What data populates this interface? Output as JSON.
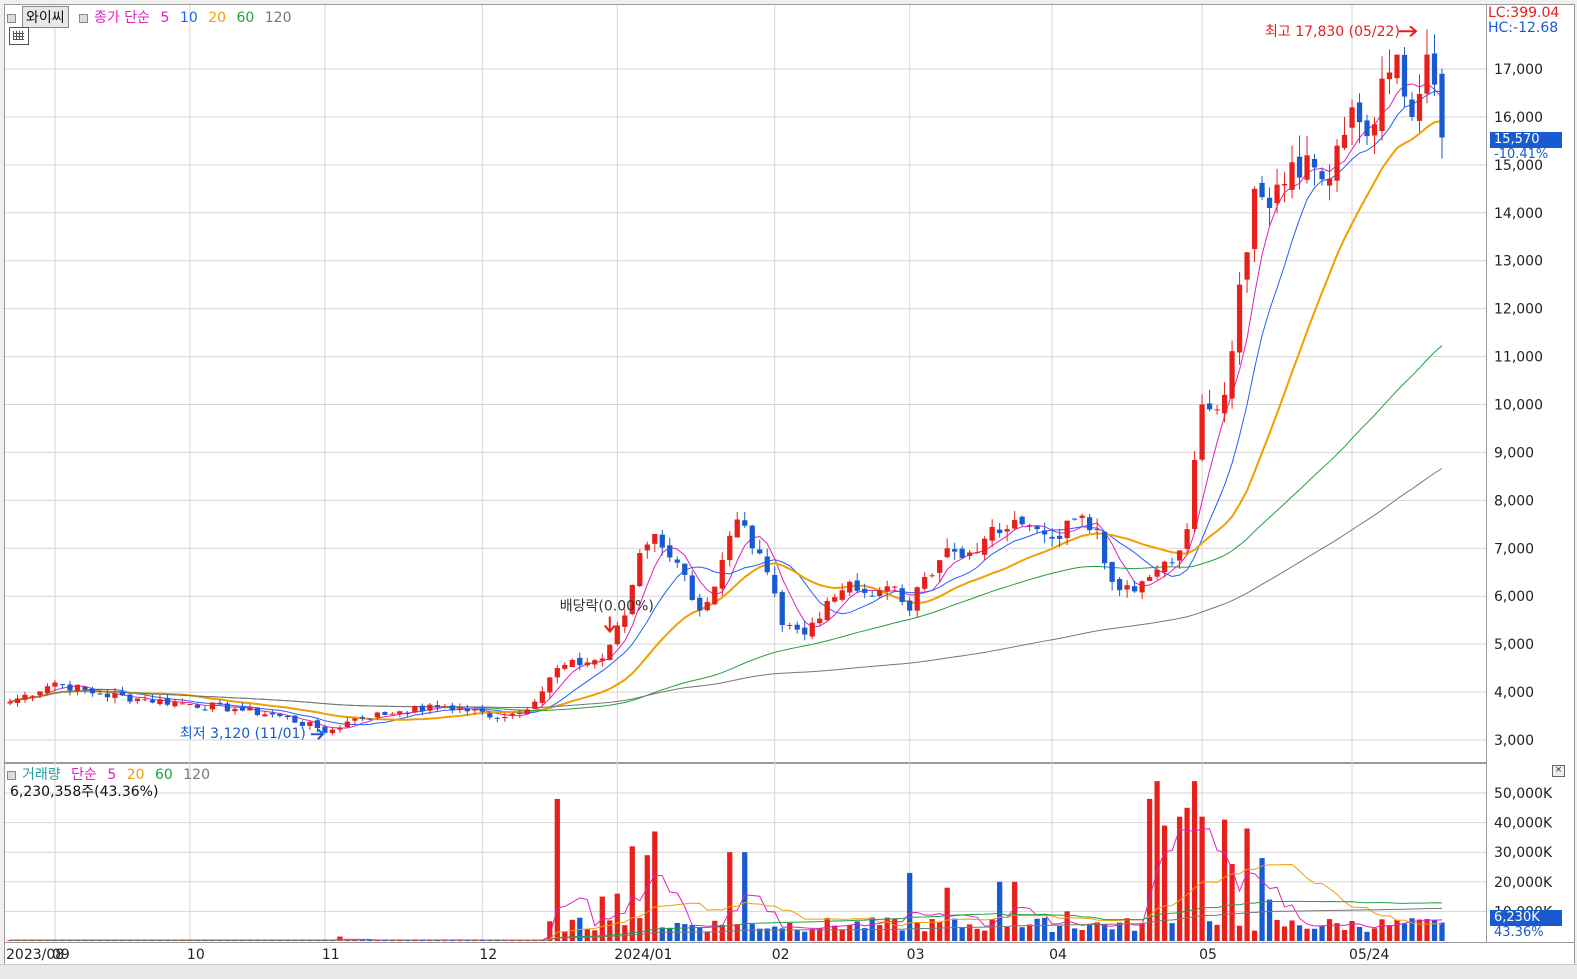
{
  "legend_price": {
    "name": "와이씨",
    "ma_label": "종가 단순",
    "periods": [
      "5",
      "10",
      "20",
      "60",
      "120"
    ],
    "period_colors": [
      "#e020c0",
      "#2060ff",
      "#f0a000",
      "#20a040",
      "#777777"
    ]
  },
  "legend_volume": {
    "label": "거래량",
    "ma_label": "단순",
    "periods": [
      "5",
      "20",
      "60",
      "120"
    ],
    "period_colors": [
      "#e020c0",
      "#f0a000",
      "#20a040",
      "#777777"
    ],
    "info": "6,230,358주(43.36%)"
  },
  "right_info": {
    "lc": "LC:399.04",
    "hc": "HC:-12.68",
    "price_tag": "15,570",
    "price_change": "-10.41%",
    "vol_tag": "6,230K",
    "vol_pct": "43.36%"
  },
  "annotations": {
    "high": "최고 17,830 (05/22)",
    "low": "최저 3,120 (11/01)",
    "dividend": "배당락(0.00%)"
  },
  "colors": {
    "up": "#e8201c",
    "down": "#1a5ad0",
    "grid": "#d6d6d6",
    "tag_bg": "#1a5ad0"
  },
  "icons": [
    "table-icon",
    "close-icon"
  ],
  "chart_data": {
    "type": "candlestick",
    "price_axis": {
      "ticks": [
        3000,
        4000,
        5000,
        6000,
        7000,
        8000,
        9000,
        10000,
        11000,
        12000,
        13000,
        14000,
        15000,
        16000,
        17000
      ],
      "labels": [
        "3,000",
        "4,000",
        "5,000",
        "6,000",
        "7,000",
        "8,000",
        "9,000",
        "10,000",
        "11,000",
        "12,000",
        "13,000",
        "14,000",
        "15,000",
        "16,000",
        "17,000"
      ],
      "range": [
        2600,
        18300
      ]
    },
    "volume_axis": {
      "ticks": [
        10000,
        20000,
        30000,
        40000,
        50000
      ],
      "labels": [
        "10,000K",
        "20,000K",
        "30,000K",
        "40,000K",
        "50,000K"
      ],
      "range": [
        0,
        55000
      ]
    },
    "date_labels": [
      {
        "label": "2023/08",
        "index": 0
      },
      {
        "label": "09",
        "index": 6
      },
      {
        "label": "10",
        "index": 24
      },
      {
        "label": "11",
        "index": 42
      },
      {
        "label": "12",
        "index": 63
      },
      {
        "label": "2024/01",
        "index": 81
      },
      {
        "label": "02",
        "index": 102
      },
      {
        "label": "03",
        "index": 120
      },
      {
        "label": "04",
        "index": 139
      },
      {
        "label": "05",
        "index": 159
      },
      {
        "label": "05/24",
        "index": 179
      }
    ],
    "high": {
      "value": 17830,
      "date": "05/22"
    },
    "low": {
      "value": 3120,
      "date": "11/01"
    },
    "anchors": [
      [
        0,
        3800
      ],
      [
        6,
        4200
      ],
      [
        12,
        3950
      ],
      [
        18,
        3850
      ],
      [
        24,
        3750
      ],
      [
        30,
        3650
      ],
      [
        36,
        3500
      ],
      [
        41,
        3250
      ],
      [
        42,
        3150
      ],
      [
        46,
        3450
      ],
      [
        52,
        3600
      ],
      [
        58,
        3700
      ],
      [
        66,
        3480
      ],
      [
        70,
        3800
      ],
      [
        73,
        4500
      ],
      [
        79,
        4700
      ],
      [
        82,
        5600
      ],
      [
        84,
        6900
      ],
      [
        86,
        7300
      ],
      [
        89,
        6700
      ],
      [
        92,
        5700
      ],
      [
        94,
        6200
      ],
      [
        97,
        7600
      ],
      [
        99,
        7000
      ],
      [
        101,
        6500
      ],
      [
        103,
        5400
      ],
      [
        106,
        5200
      ],
      [
        109,
        5900
      ],
      [
        112,
        6300
      ],
      [
        115,
        6000
      ],
      [
        118,
        6200
      ],
      [
        120,
        5700
      ],
      [
        122,
        6400
      ],
      [
        125,
        7000
      ],
      [
        127,
        6800
      ],
      [
        130,
        7200
      ],
      [
        133,
        7400
      ],
      [
        135,
        7500
      ],
      [
        137,
        7400
      ],
      [
        139,
        7200
      ],
      [
        142,
        7600
      ],
      [
        145,
        7400
      ],
      [
        147,
        6300
      ],
      [
        150,
        6100
      ],
      [
        152,
        6400
      ],
      [
        155,
        6700
      ],
      [
        157,
        7400
      ],
      [
        159,
        10000
      ],
      [
        162,
        10200
      ],
      [
        164,
        12500
      ],
      [
        166,
        14500
      ],
      [
        168,
        14100
      ],
      [
        170,
        14600
      ],
      [
        173,
        15200
      ],
      [
        175,
        14700
      ],
      [
        177,
        15400
      ],
      [
        179,
        16200
      ],
      [
        181,
        15600
      ],
      [
        183,
        16800
      ],
      [
        185,
        17300
      ],
      [
        187,
        16000
      ],
      [
        189,
        17300
      ],
      [
        191,
        15570
      ]
    ],
    "volume_spikes": {
      "73": 48000,
      "79": 15000,
      "81": 16000,
      "83": 32000,
      "85": 29000,
      "86": 37000,
      "96": 30000,
      "98": 30000,
      "120": 23000,
      "125": 18000,
      "132": 20000,
      "134": 20000,
      "141": 10000,
      "151": 6000,
      "152": 48000,
      "153": 54000,
      "154": 39000,
      "156": 42000,
      "157": 45000,
      "158": 54000,
      "159": 42000,
      "162": 41000,
      "163": 26000,
      "165": 38000,
      "167": 28000,
      "168": 14000
    }
  }
}
